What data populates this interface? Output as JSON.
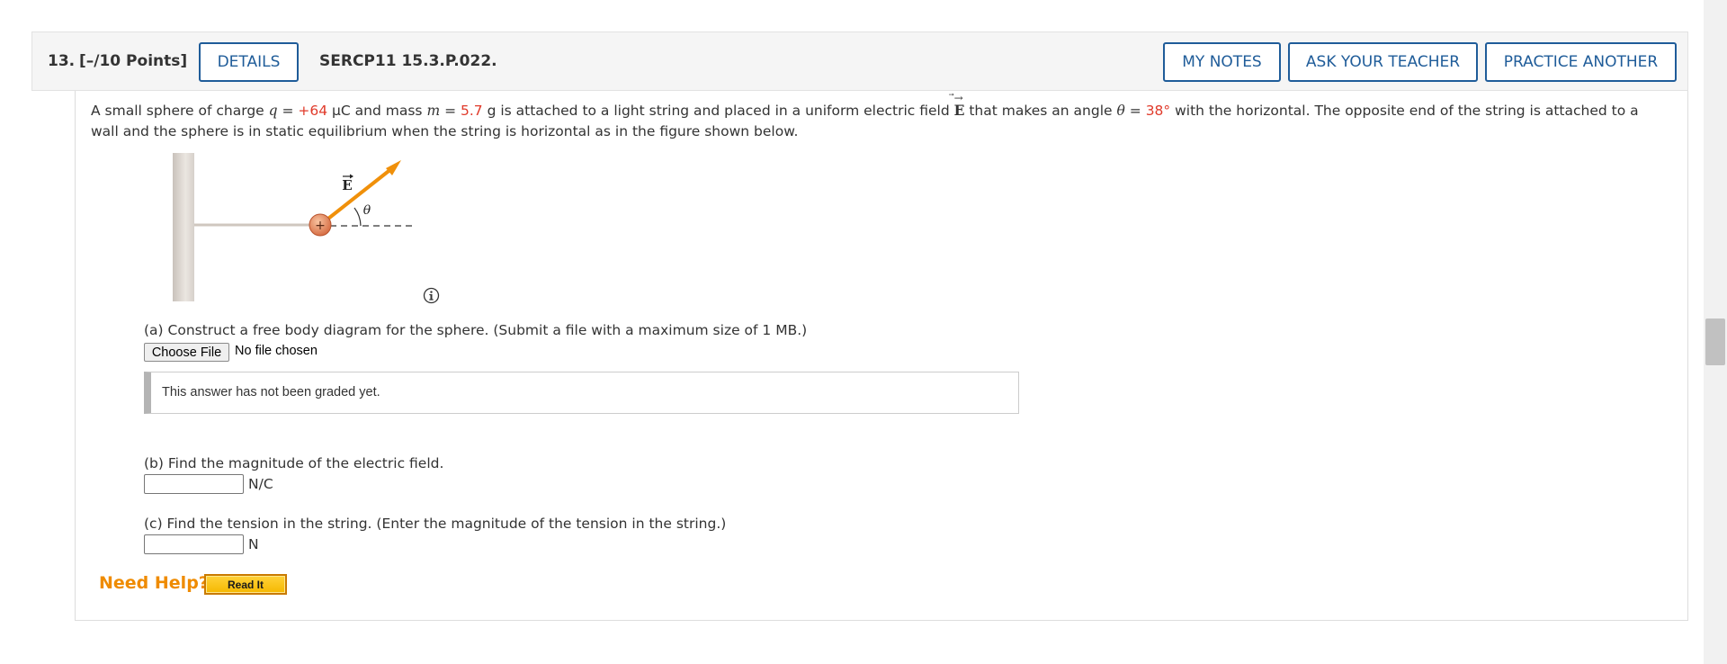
{
  "header": {
    "question_number": "13.",
    "points": "[–/10 Points]",
    "details_label": "DETAILS",
    "code": "SERCP11 15.3.P.022.",
    "my_notes_label": "MY NOTES",
    "ask_teacher_label": "ASK YOUR TEACHER",
    "practice_another_label": "PRACTICE ANOTHER"
  },
  "problem": {
    "t1": "A small sphere of charge ",
    "q_var": "q",
    "eq1": " = ",
    "q_val": "+64",
    "t2": " μC and mass ",
    "m_var": "m",
    "eq2": " = ",
    "m_val": "5.7",
    "t3": " g is attached to a light string and placed in a uniform electric field ",
    "e_vec": "E",
    "t4": " that makes an angle ",
    "theta_var": "θ",
    "eq3": " = ",
    "theta_val": "38°",
    "t5": " with the horizontal. The opposite end of the string is attached to a wall and the sphere is in static equilibrium when the string is horizontal as in the figure shown below."
  },
  "figure": {
    "field_label": "E",
    "angle_label": "θ",
    "charge_sign": "+"
  },
  "part_a": {
    "label": "(a) Construct a free body diagram for the sphere. (Submit a file with a maximum size of 1 MB.)",
    "choose_file_label": "Choose File",
    "file_status": "No file chosen",
    "graded_message": "This answer has not been graded yet."
  },
  "part_b": {
    "label": "(b) Find the magnitude of the electric field.",
    "value": "",
    "unit": "N/C"
  },
  "part_c": {
    "label": "(c) Find the tension in the string. (Enter the magnitude of the tension in the string.)",
    "value": "",
    "unit": "N"
  },
  "help": {
    "need_help_label": "Need Help?",
    "read_it_label": "Read It"
  },
  "colors": {
    "accent_blue": "#1f5c99",
    "given_value_red": "#e03a2a",
    "help_orange": "#ef8b00",
    "arrow_orange": "#f0900a"
  },
  "icons": [
    "info-icon",
    "scrollbar-thumb"
  ]
}
